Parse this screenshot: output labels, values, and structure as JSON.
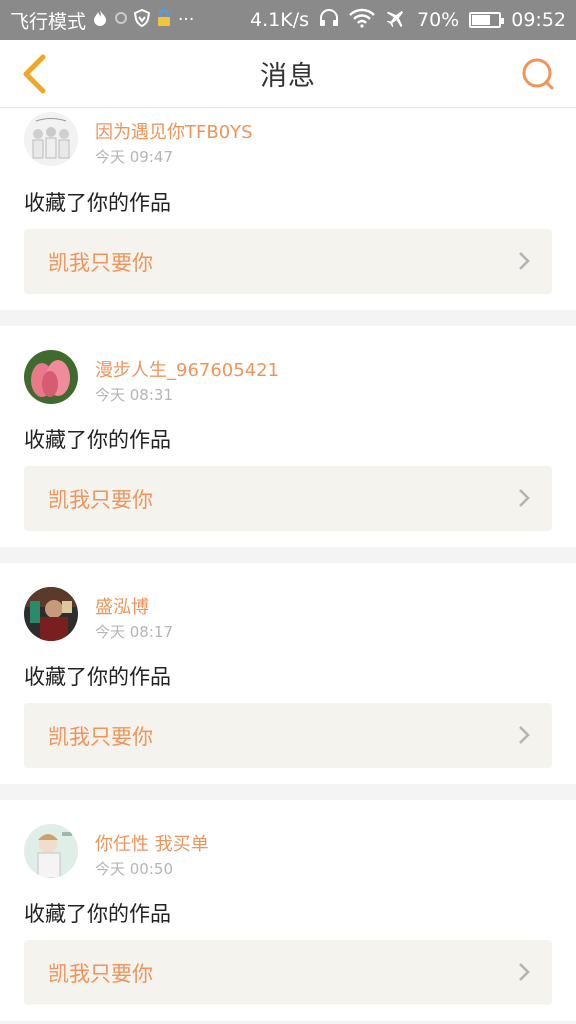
{
  "status_bar": {
    "mode": "飞行模式",
    "speed": "4.1K/s",
    "battery_percent": "70%",
    "time": "09:52",
    "battery_level": 0.7
  },
  "header": {
    "title": "消息",
    "back_icon": "chevron-left-icon",
    "search_icon": "search-icon",
    "accent": "#f0945a"
  },
  "messages": [
    {
      "user": "因为遇见你TFB0YS",
      "time": "今天 09:47",
      "action": "收藏了你的作品",
      "work": "凯我只要你"
    },
    {
      "user": "漫步人生_967605421",
      "time": "今天 08:31",
      "action": "收藏了你的作品",
      "work": "凯我只要你"
    },
    {
      "user": "盛泓博",
      "time": "今天 08:17",
      "action": "收藏了你的作品",
      "work": "凯我只要你"
    },
    {
      "user": "你任性 我买单",
      "time": "今天 00:50",
      "action": "收藏了你的作品",
      "work": "凯我只要你"
    }
  ]
}
